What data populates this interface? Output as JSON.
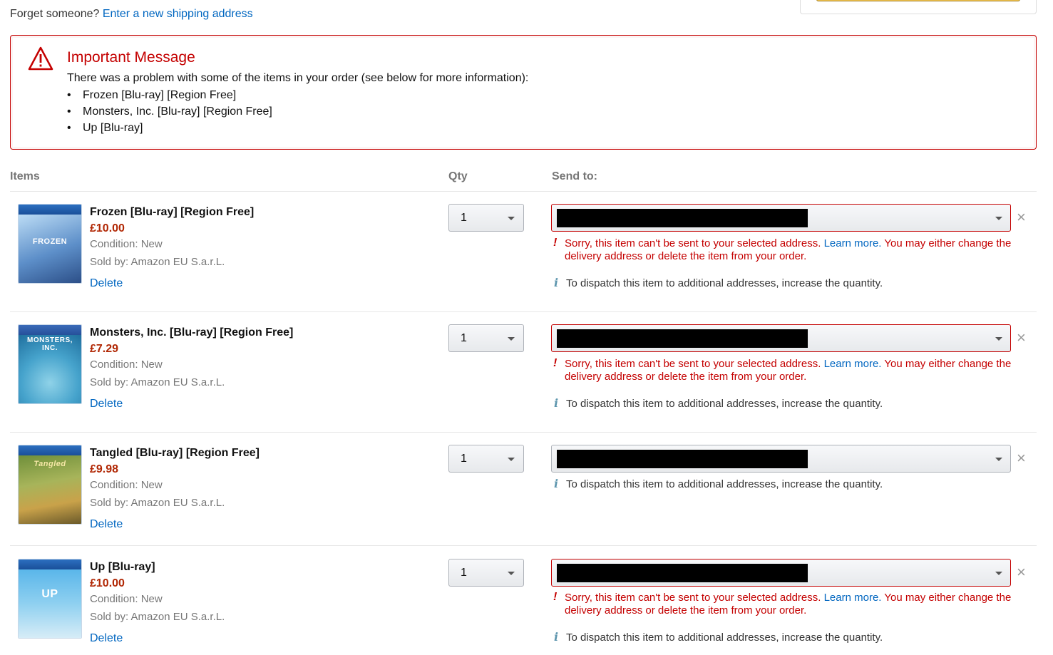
{
  "top": {
    "prefix": "Forget someone?",
    "link": "Enter a new shipping address"
  },
  "alert": {
    "title": "Important Message",
    "text": "There was a problem with some of the items in your order (see below for more information):",
    "items": [
      "Frozen [Blu-ray] [Region Free]",
      "Monsters, Inc. [Blu-ray] [Region Free]",
      "Up [Blu-ray]"
    ]
  },
  "headers": {
    "items": "Items",
    "qty": "Qty",
    "send_to": "Send to:"
  },
  "messages": {
    "error_part1": "Sorry, this item can't be sent to your selected address.",
    "learn_more": "Learn more.",
    "error_part2": "You may either change the delivery address or delete the item from your order.",
    "info": "To dispatch this item to additional addresses, increase the quantity.",
    "delete": "Delete",
    "close": "×"
  },
  "items": [
    {
      "title": "Frozen [Blu-ray] [Region Free]",
      "price": "£10.00",
      "condition": "Condition: New",
      "seller": "Sold by: Amazon EU S.a.r.L.",
      "qty": "1",
      "error": true,
      "cover_logo": "FROZEN"
    },
    {
      "title": "Monsters, Inc. [Blu-ray] [Region Free]",
      "price": "£7.29",
      "condition": "Condition: New",
      "seller": "Sold by: Amazon EU S.a.r.L.",
      "qty": "1",
      "error": true,
      "cover_logo": "MONSTERS, INC."
    },
    {
      "title": "Tangled [Blu-ray] [Region Free]",
      "price": "£9.98",
      "condition": "Condition: New",
      "seller": "Sold by: Amazon EU S.a.r.L.",
      "qty": "1",
      "error": false,
      "cover_logo": "Tangled"
    },
    {
      "title": "Up [Blu-ray]",
      "price": "£10.00",
      "condition": "Condition: New",
      "seller": "Sold by: Amazon EU S.a.r.L.",
      "qty": "1",
      "error": true,
      "cover_logo": "UP"
    }
  ],
  "colors": {
    "link": "#0066c0",
    "error": "#c40000",
    "price": "#b12704",
    "muted": "#767676"
  }
}
